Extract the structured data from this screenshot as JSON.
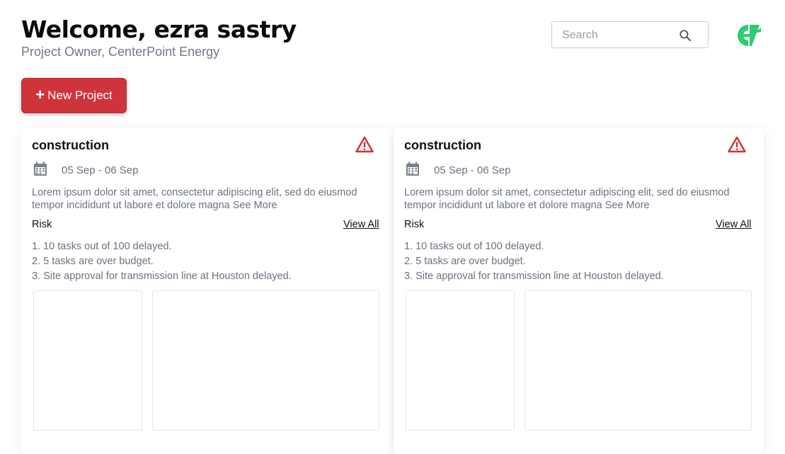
{
  "header": {
    "title": "Welcome, ezra sastry",
    "subtitle": "Project Owner, CenterPoint Energy"
  },
  "search": {
    "placeholder": "Search",
    "icon": "search-icon"
  },
  "logo": {
    "icon": "brand-logo-icon",
    "color": "#2ecc71"
  },
  "new_project": {
    "plus": "+",
    "label": "New Project",
    "color": "#cf343b"
  },
  "cards": [
    {
      "title": "construction",
      "status_icon": "warning-icon",
      "status_color": "#d32f2f",
      "date_range": "05 Sep - 06 Sep",
      "description": "Lorem ipsum dolor sit amet, consectetur adipiscing elit, sed do eiusmod tempor incididunt ut labore et dolore magna",
      "see_more": "See More",
      "risk_label": "Risk",
      "view_all": "View All",
      "risks": [
        "1. 10 tasks out of 100 delayed.",
        "2. 5 tasks are over budget.",
        "3. Site approval for transmission line at Houston delayed."
      ]
    },
    {
      "title": "construction",
      "status_icon": "warning-icon",
      "status_color": "#d32f2f",
      "date_range": "05 Sep - 06 Sep",
      "description": "Lorem ipsum dolor sit amet, consectetur adipiscing elit, sed do eiusmod tempor incididunt ut labore et dolore magna",
      "see_more": "See More",
      "risk_label": "Risk",
      "view_all": "View All",
      "risks": [
        "1. 10 tasks out of 100 delayed.",
        "2. 5 tasks are over budget.",
        "3. Site approval for transmission line at Houston delayed."
      ]
    }
  ]
}
